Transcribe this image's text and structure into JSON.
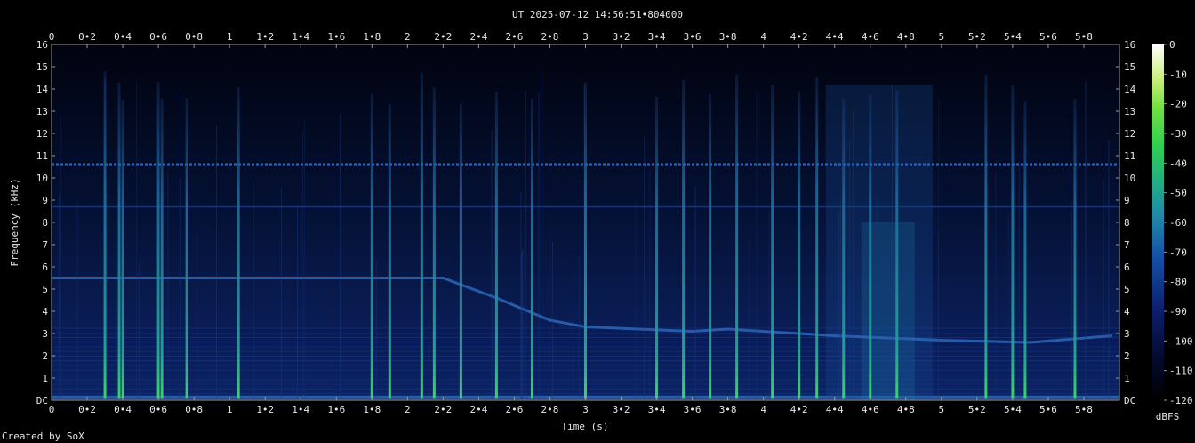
{
  "title": "UT 2025-07-12 14:56:51•804000",
  "credit": "Created by SoX",
  "chart_data": {
    "type": "heatmap",
    "title": "UT 2025-07-12 14:56:51•804000",
    "xlabel": "Time (s)",
    "ylabel": "Frequency (kHz)",
    "xlim": [
      0,
      6
    ],
    "ylim": [
      0,
      16
    ],
    "x_ticks": [
      "0",
      "0•2",
      "0•4",
      "0•6",
      "0•8",
      "1",
      "1•2",
      "1•4",
      "1•6",
      "1•8",
      "2",
      "2•2",
      "2•4",
      "2•6",
      "2•8",
      "3",
      "3•2",
      "3•4",
      "3•6",
      "3•8",
      "4",
      "4•2",
      "4•4",
      "4•6",
      "4•8",
      "5",
      "5•2",
      "5•4",
      "5•6",
      "5•8"
    ],
    "y_ticks": [
      "DC",
      "1",
      "2",
      "3",
      "4",
      "5",
      "6",
      "7",
      "8",
      "9",
      "10",
      "11",
      "12",
      "13",
      "14",
      "15",
      "16"
    ],
    "colorbar": {
      "label": "dBFS",
      "ticks": [
        "0",
        "-10",
        "-20",
        "-30",
        "-40",
        "-50",
        "-60",
        "-70",
        "-80",
        "-90",
        "-100",
        "-110",
        "-120"
      ],
      "range": [
        -120,
        0
      ]
    },
    "colors": {
      "background": "#000000",
      "plot_bg": "#020518",
      "noise": "#0a1a5a",
      "mid": "#1a5aa8",
      "strong": "#22a0a0",
      "peak": "#33e060"
    },
    "features": {
      "tone_line_khz": 10.6,
      "weak_tone_khz": 8.7,
      "sweep_khz": [
        [
          0,
          5.5
        ],
        [
          2.2,
          5.5
        ],
        [
          2.5,
          4.6
        ],
        [
          2.8,
          3.6
        ],
        [
          3.0,
          3.3
        ],
        [
          3.6,
          3.1
        ],
        [
          3.8,
          3.2
        ],
        [
          4.4,
          2.9
        ],
        [
          5.0,
          2.7
        ],
        [
          5.5,
          2.6
        ],
        [
          5.96,
          2.9
        ]
      ],
      "clicks_s": [
        0.3,
        0.38,
        0.4,
        0.6,
        0.62,
        0.76,
        1.05,
        1.8,
        1.9,
        2.08,
        2.15,
        2.3,
        2.5,
        2.7,
        3.0,
        3.4,
        3.55,
        3.7,
        3.85,
        4.05,
        4.2,
        4.3,
        4.45,
        4.6,
        4.75,
        5.25,
        5.4,
        5.47,
        5.75
      ]
    }
  }
}
